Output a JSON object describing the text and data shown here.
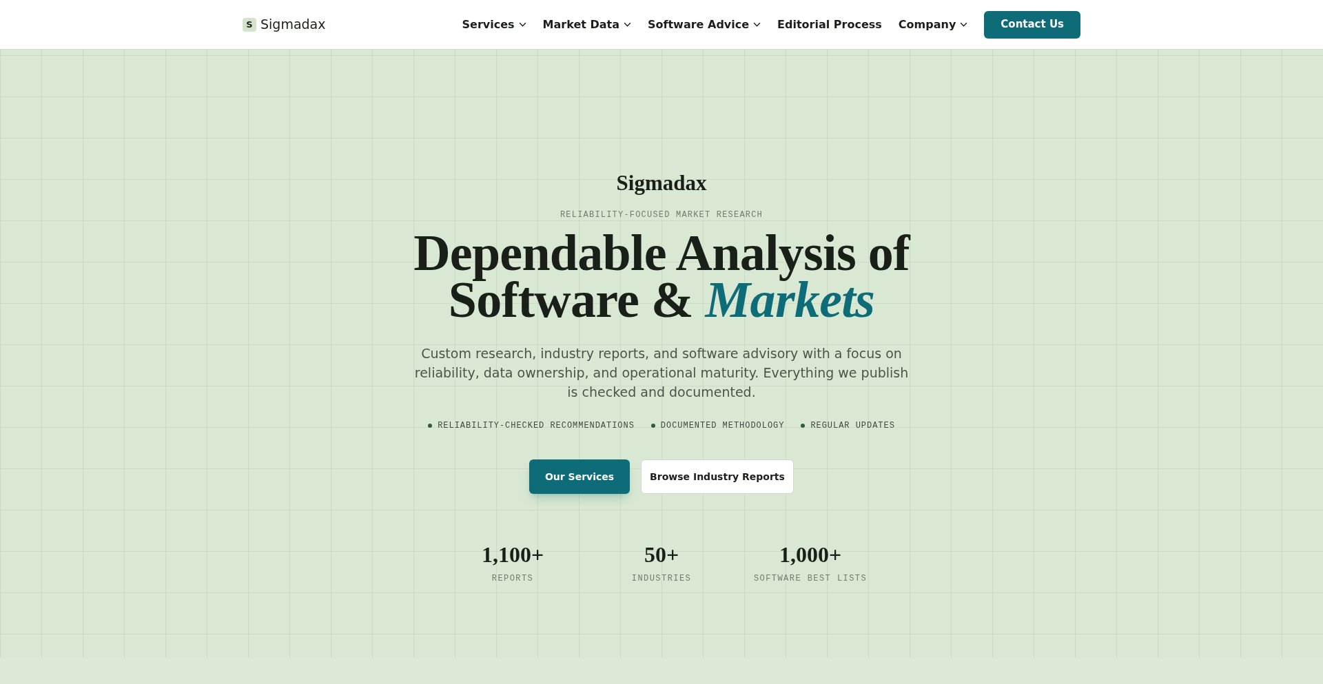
{
  "header": {
    "logo_mark": "S",
    "logo_text": "Sigmadax",
    "nav": [
      {
        "label": "Services",
        "has_dropdown": true
      },
      {
        "label": "Market Data",
        "has_dropdown": true
      },
      {
        "label": "Software Advice",
        "has_dropdown": true
      },
      {
        "label": "Editorial Process",
        "has_dropdown": false
      },
      {
        "label": "Company",
        "has_dropdown": true
      }
    ],
    "cta": "Contact Us"
  },
  "hero": {
    "brand": "Sigmadax",
    "eyebrow": "RELIABILITY-FOCUSED MARKET RESEARCH",
    "title_line_1": "Dependable Analysis of",
    "title_line_2": "Software & *Markets*",
    "description": "Custom research, industry reports, and software advisory with a focus on reliability, data ownership, and operational maturity. Everything we publish is checked and documented.",
    "features": [
      "RELIABILITY-CHECKED RECOMMENDATIONS",
      "DOCUMENTED METHODOLOGY",
      "REGULAR UPDATES"
    ],
    "buttons": [
      {
        "label": "Our Services",
        "kind": "primary"
      },
      {
        "label": "Browse Industry Reports",
        "kind": "secondary"
      }
    ],
    "stats": [
      {
        "value": "1,100+",
        "label": "REPORTS"
      },
      {
        "value": "50+",
        "label": "INDUSTRIES"
      },
      {
        "value": "1,000+",
        "label": "SOFTWARE BEST LISTS"
      }
    ]
  }
}
